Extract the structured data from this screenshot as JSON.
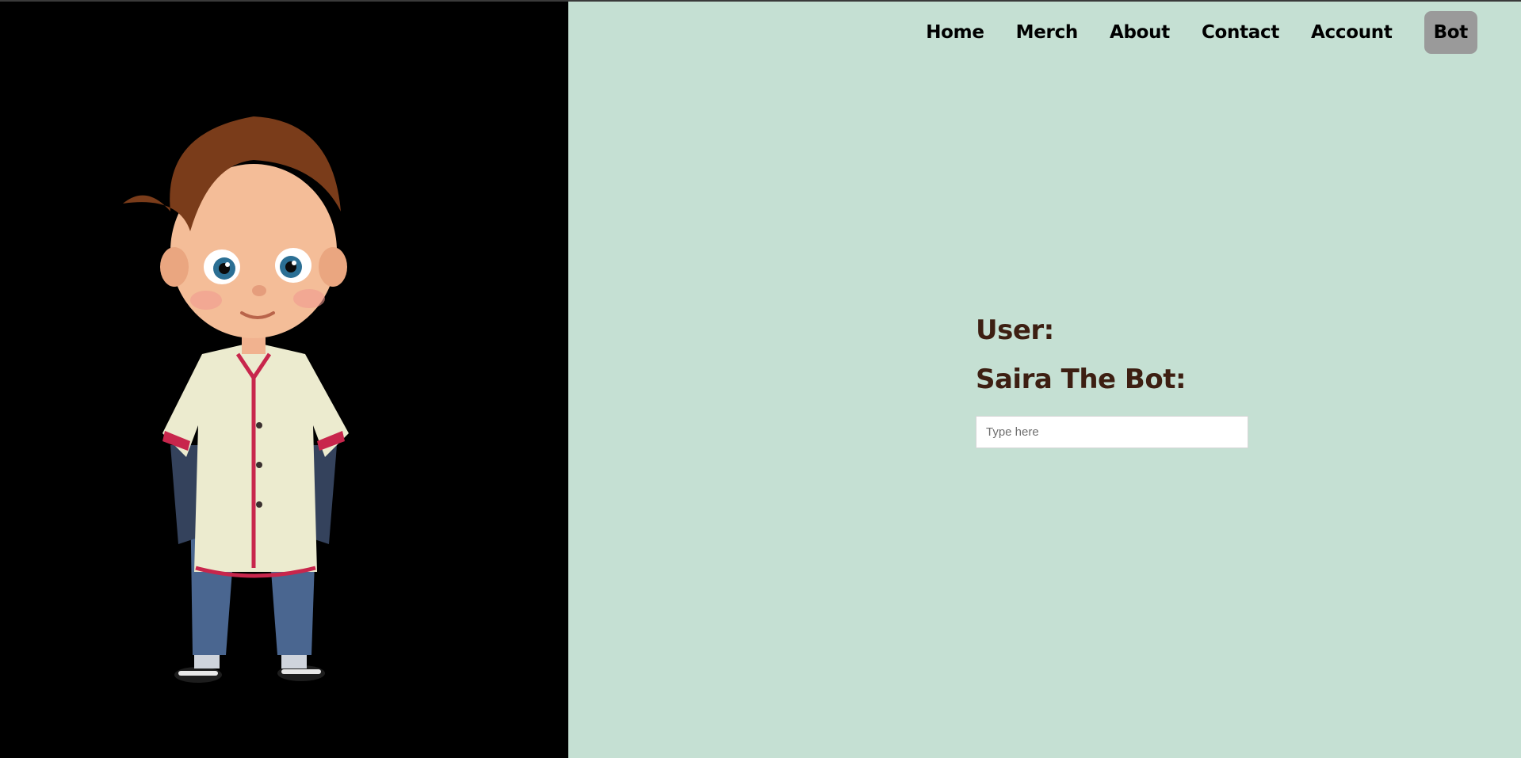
{
  "nav": {
    "items": [
      {
        "label": "Home"
      },
      {
        "label": "Merch"
      },
      {
        "label": "About"
      },
      {
        "label": "Contact"
      },
      {
        "label": "Account"
      }
    ],
    "active": {
      "label": "Bot"
    }
  },
  "chat": {
    "user_label": "User:",
    "bot_label": "Saira The Bot:",
    "input_placeholder": "Type here",
    "input_value": ""
  },
  "colors": {
    "left_bg": "#000000",
    "right_bg": "#c5e0d3",
    "label_color": "#3d1f12",
    "active_nav_bg": "#9a9a9a"
  },
  "hero_image": {
    "icon": "cartoon-boy-character"
  }
}
